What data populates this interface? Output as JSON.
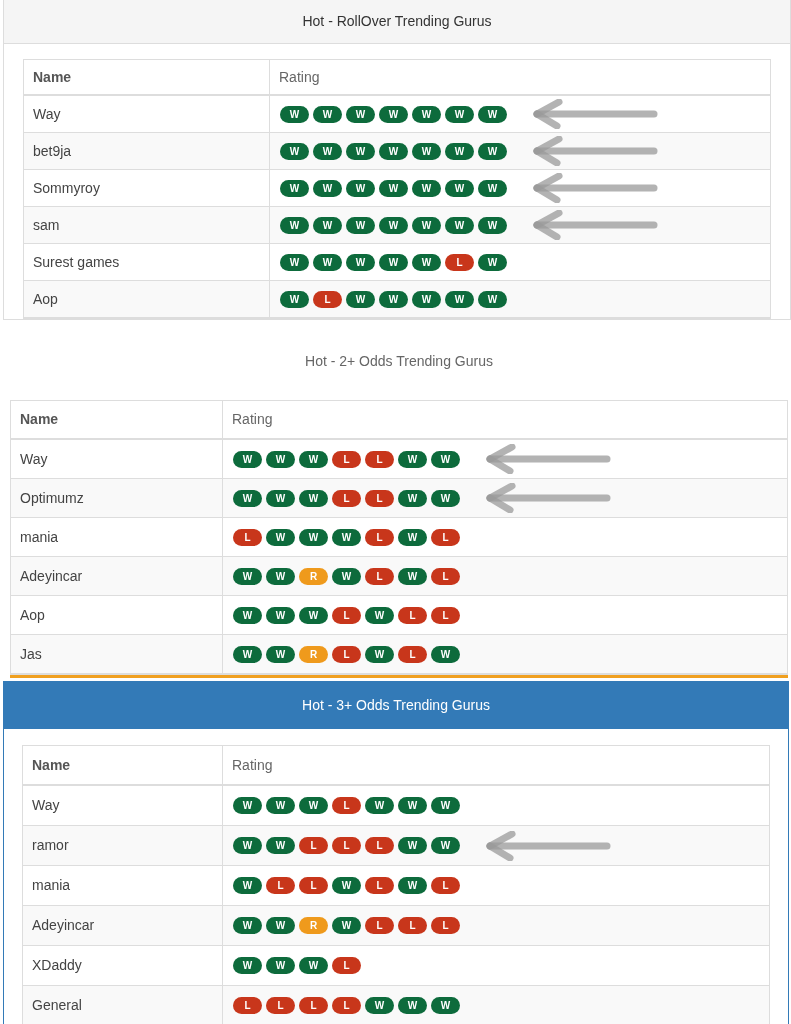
{
  "sections": [
    {
      "kind": "grey_header",
      "title": "Hot - RollOver Trending Gurus",
      "columns": [
        "Name",
        "Rating"
      ],
      "rows": [
        {
          "name": "Way",
          "arrow_mark": true,
          "results": [
            {
              "label": "W",
              "color": "#0d6b3c"
            },
            {
              "label": "W",
              "color": "#0d6b3c"
            },
            {
              "label": "W",
              "color": "#0d6b3c"
            },
            {
              "label": "W",
              "color": "#0d6b3c"
            },
            {
              "label": "W",
              "color": "#0d6b3c"
            },
            {
              "label": "W",
              "color": "#0d6b3c"
            },
            {
              "label": "W",
              "color": "#0d6b3c"
            }
          ]
        },
        {
          "name": "bet9ja",
          "arrow_mark": true,
          "results": [
            {
              "label": "W",
              "color": "#0d6b3c"
            },
            {
              "label": "W",
              "color": "#0d6b3c"
            },
            {
              "label": "W",
              "color": "#0d6b3c"
            },
            {
              "label": "W",
              "color": "#0d6b3c"
            },
            {
              "label": "W",
              "color": "#0d6b3c"
            },
            {
              "label": "W",
              "color": "#0d6b3c"
            },
            {
              "label": "W",
              "color": "#0d6b3c"
            }
          ]
        },
        {
          "name": "Sommyroy",
          "arrow_mark": true,
          "results": [
            {
              "label": "W",
              "color": "#0d6b3c"
            },
            {
              "label": "W",
              "color": "#0d6b3c"
            },
            {
              "label": "W",
              "color": "#0d6b3c"
            },
            {
              "label": "W",
              "color": "#0d6b3c"
            },
            {
              "label": "W",
              "color": "#0d6b3c"
            },
            {
              "label": "W",
              "color": "#0d6b3c"
            },
            {
              "label": "W",
              "color": "#0d6b3c"
            }
          ]
        },
        {
          "name": "sam",
          "arrow_mark": true,
          "results": [
            {
              "label": "W",
              "color": "#0d6b3c"
            },
            {
              "label": "W",
              "color": "#0d6b3c"
            },
            {
              "label": "W",
              "color": "#0d6b3c"
            },
            {
              "label": "W",
              "color": "#0d6b3c"
            },
            {
              "label": "W",
              "color": "#0d6b3c"
            },
            {
              "label": "W",
              "color": "#0d6b3c"
            },
            {
              "label": "W",
              "color": "#0d6b3c"
            }
          ]
        },
        {
          "name": "Surest games",
          "arrow_mark": false,
          "results": [
            {
              "label": "W",
              "color": "#0d6b3c"
            },
            {
              "label": "W",
              "color": "#0d6b3c"
            },
            {
              "label": "W",
              "color": "#0d6b3c"
            },
            {
              "label": "W",
              "color": "#0d6b3c"
            },
            {
              "label": "W",
              "color": "#0d6b3c"
            },
            {
              "label": "L",
              "color": "#c8361b"
            },
            {
              "label": "W",
              "color": "#0d6b3c"
            }
          ]
        },
        {
          "name": "Aop",
          "arrow_mark": false,
          "results": [
            {
              "label": "W",
              "color": "#0d6b3c"
            },
            {
              "label": "L",
              "color": "#c8361b"
            },
            {
              "label": "W",
              "color": "#0d6b3c"
            },
            {
              "label": "W",
              "color": "#0d6b3c"
            },
            {
              "label": "W",
              "color": "#0d6b3c"
            },
            {
              "label": "W",
              "color": "#0d6b3c"
            },
            {
              "label": "W",
              "color": "#0d6b3c"
            }
          ]
        }
      ]
    },
    {
      "kind": "plain",
      "title": "Hot - 2+ Odds Trending Gurus",
      "columns": [
        "Name",
        "Rating"
      ],
      "rows": [
        {
          "name": "Way",
          "arrow_mark": true,
          "results": [
            {
              "label": "W",
              "color": "#0d6b3c"
            },
            {
              "label": "W",
              "color": "#0d6b3c"
            },
            {
              "label": "W",
              "color": "#0d6b3c"
            },
            {
              "label": "L",
              "color": "#c8361b"
            },
            {
              "label": "L",
              "color": "#c8361b"
            },
            {
              "label": "W",
              "color": "#0d6b3c"
            },
            {
              "label": "W",
              "color": "#0d6b3c"
            }
          ]
        },
        {
          "name": "Optimumz",
          "arrow_mark": true,
          "results": [
            {
              "label": "W",
              "color": "#0d6b3c"
            },
            {
              "label": "W",
              "color": "#0d6b3c"
            },
            {
              "label": "W",
              "color": "#0d6b3c"
            },
            {
              "label": "L",
              "color": "#c8361b"
            },
            {
              "label": "L",
              "color": "#c8361b"
            },
            {
              "label": "W",
              "color": "#0d6b3c"
            },
            {
              "label": "W",
              "color": "#0d6b3c"
            }
          ]
        },
        {
          "name": "mania",
          "arrow_mark": false,
          "results": [
            {
              "label": "L",
              "color": "#c8361b"
            },
            {
              "label": "W",
              "color": "#0d6b3c"
            },
            {
              "label": "W",
              "color": "#0d6b3c"
            },
            {
              "label": "W",
              "color": "#0d6b3c"
            },
            {
              "label": "L",
              "color": "#c8361b"
            },
            {
              "label": "W",
              "color": "#0d6b3c"
            },
            {
              "label": "L",
              "color": "#c8361b"
            }
          ]
        },
        {
          "name": "Adeyincar",
          "arrow_mark": false,
          "results": [
            {
              "label": "W",
              "color": "#0d6b3c"
            },
            {
              "label": "W",
              "color": "#0d6b3c"
            },
            {
              "label": "R",
              "color": "#ef9a1c"
            },
            {
              "label": "W",
              "color": "#0d6b3c"
            },
            {
              "label": "L",
              "color": "#c8361b"
            },
            {
              "label": "W",
              "color": "#0d6b3c"
            },
            {
              "label": "L",
              "color": "#c8361b"
            }
          ]
        },
        {
          "name": "Aop",
          "arrow_mark": false,
          "results": [
            {
              "label": "W",
              "color": "#0d6b3c"
            },
            {
              "label": "W",
              "color": "#0d6b3c"
            },
            {
              "label": "W",
              "color": "#0d6b3c"
            },
            {
              "label": "L",
              "color": "#c8361b"
            },
            {
              "label": "W",
              "color": "#0d6b3c"
            },
            {
              "label": "L",
              "color": "#c8361b"
            },
            {
              "label": "L",
              "color": "#c8361b"
            }
          ]
        },
        {
          "name": "Jas",
          "arrow_mark": false,
          "results": [
            {
              "label": "W",
              "color": "#0d6b3c"
            },
            {
              "label": "W",
              "color": "#0d6b3c"
            },
            {
              "label": "R",
              "color": "#ef9a1c"
            },
            {
              "label": "L",
              "color": "#c8361b"
            },
            {
              "label": "W",
              "color": "#0d6b3c"
            },
            {
              "label": "L",
              "color": "#c8361b"
            },
            {
              "label": "W",
              "color": "#0d6b3c"
            }
          ]
        }
      ]
    },
    {
      "kind": "blue_header",
      "title": "Hot - 3+ Odds Trending Gurus",
      "columns": [
        "Name",
        "Rating"
      ],
      "rows": [
        {
          "name": "Way",
          "arrow_mark": false,
          "results": [
            {
              "label": "W",
              "color": "#0d6b3c"
            },
            {
              "label": "W",
              "color": "#0d6b3c"
            },
            {
              "label": "W",
              "color": "#0d6b3c"
            },
            {
              "label": "L",
              "color": "#c8361b"
            },
            {
              "label": "W",
              "color": "#0d6b3c"
            },
            {
              "label": "W",
              "color": "#0d6b3c"
            },
            {
              "label": "W",
              "color": "#0d6b3c"
            }
          ]
        },
        {
          "name": "ramor",
          "arrow_mark": true,
          "results": [
            {
              "label": "W",
              "color": "#0d6b3c"
            },
            {
              "label": "W",
              "color": "#0d6b3c"
            },
            {
              "label": "L",
              "color": "#c8361b"
            },
            {
              "label": "L",
              "color": "#c8361b"
            },
            {
              "label": "L",
              "color": "#c8361b"
            },
            {
              "label": "W",
              "color": "#0d6b3c"
            },
            {
              "label": "W",
              "color": "#0d6b3c"
            }
          ]
        },
        {
          "name": "mania",
          "arrow_mark": false,
          "results": [
            {
              "label": "W",
              "color": "#0d6b3c"
            },
            {
              "label": "L",
              "color": "#c8361b"
            },
            {
              "label": "L",
              "color": "#c8361b"
            },
            {
              "label": "W",
              "color": "#0d6b3c"
            },
            {
              "label": "L",
              "color": "#c8361b"
            },
            {
              "label": "W",
              "color": "#0d6b3c"
            },
            {
              "label": "L",
              "color": "#c8361b"
            }
          ]
        },
        {
          "name": "Adeyincar",
          "arrow_mark": false,
          "results": [
            {
              "label": "W",
              "color": "#0d6b3c"
            },
            {
              "label": "W",
              "color": "#0d6b3c"
            },
            {
              "label": "R",
              "color": "#ef9a1c"
            },
            {
              "label": "W",
              "color": "#0d6b3c"
            },
            {
              "label": "L",
              "color": "#c8361b"
            },
            {
              "label": "L",
              "color": "#c8361b"
            },
            {
              "label": "L",
              "color": "#c8361b"
            }
          ]
        },
        {
          "name": "XDaddy",
          "arrow_mark": false,
          "results": [
            {
              "label": "W",
              "color": "#0d6b3c"
            },
            {
              "label": "W",
              "color": "#0d6b3c"
            },
            {
              "label": "W",
              "color": "#0d6b3c"
            },
            {
              "label": "L",
              "color": "#c8361b"
            }
          ]
        },
        {
          "name": "General",
          "arrow_mark": false,
          "results": [
            {
              "label": "L",
              "color": "#c8361b"
            },
            {
              "label": "L",
              "color": "#c8361b"
            },
            {
              "label": "L",
              "color": "#c8361b"
            },
            {
              "label": "L",
              "color": "#c8361b"
            },
            {
              "label": "W",
              "color": "#0d6b3c"
            },
            {
              "label": "W",
              "color": "#0d6b3c"
            },
            {
              "label": "W",
              "color": "#0d6b3c"
            }
          ]
        }
      ]
    }
  ]
}
